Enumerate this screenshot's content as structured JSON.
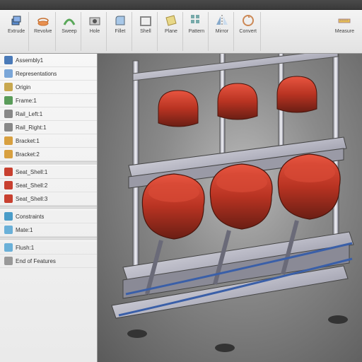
{
  "ribbon": {
    "groups": [
      {
        "label": "Extrude",
        "icon": "extrude"
      },
      {
        "label": "Revolve",
        "icon": "revolve"
      },
      {
        "label": "Sweep",
        "icon": "sweep"
      },
      {
        "label": "Hole",
        "icon": "hole"
      },
      {
        "label": "Fillet",
        "icon": "fillet"
      },
      {
        "label": "Shell",
        "icon": "shell"
      },
      {
        "label": "Plane",
        "icon": "plane"
      },
      {
        "label": "Pattern",
        "icon": "pattern"
      },
      {
        "label": "Mirror",
        "icon": "mirror"
      },
      {
        "label": "Convert",
        "icon": "convert"
      }
    ],
    "far": {
      "label": "Measure",
      "icon": "measure"
    }
  },
  "panel": {
    "items": [
      {
        "label": "Assembly1",
        "color": "#4a7ab8"
      },
      {
        "label": "Representations",
        "color": "#7aa6d8"
      },
      {
        "label": "Origin",
        "color": "#c8a850"
      },
      {
        "label": "Frame:1",
        "color": "#5a9c5a"
      },
      {
        "label": "Rail_Left:1",
        "color": "#888"
      },
      {
        "label": "Rail_Right:1",
        "color": "#888"
      },
      {
        "label": "Bracket:1",
        "color": "#d8a040"
      },
      {
        "label": "Bracket:2",
        "color": "#d8a040"
      },
      {
        "sep": true
      },
      {
        "label": "Seat_Shell:1",
        "color": "#c84030"
      },
      {
        "label": "Seat_Shell:2",
        "color": "#c84030"
      },
      {
        "label": "Seat_Shell:3",
        "color": "#c84030"
      },
      {
        "sep": true
      },
      {
        "label": "Constraints",
        "color": "#4a9cc8"
      },
      {
        "label": "Mate:1",
        "color": "#6ab0d8"
      },
      {
        "sep": true
      },
      {
        "label": "Flush:1",
        "color": "#6ab0d8"
      },
      {
        "label": "End of Features",
        "color": "#999"
      }
    ]
  },
  "colors": {
    "seat": "#b83322",
    "seatHi": "#e85540",
    "frame": "#d8d8e0",
    "frameDk": "#8a8a98",
    "accent": "#3a5fa8"
  }
}
